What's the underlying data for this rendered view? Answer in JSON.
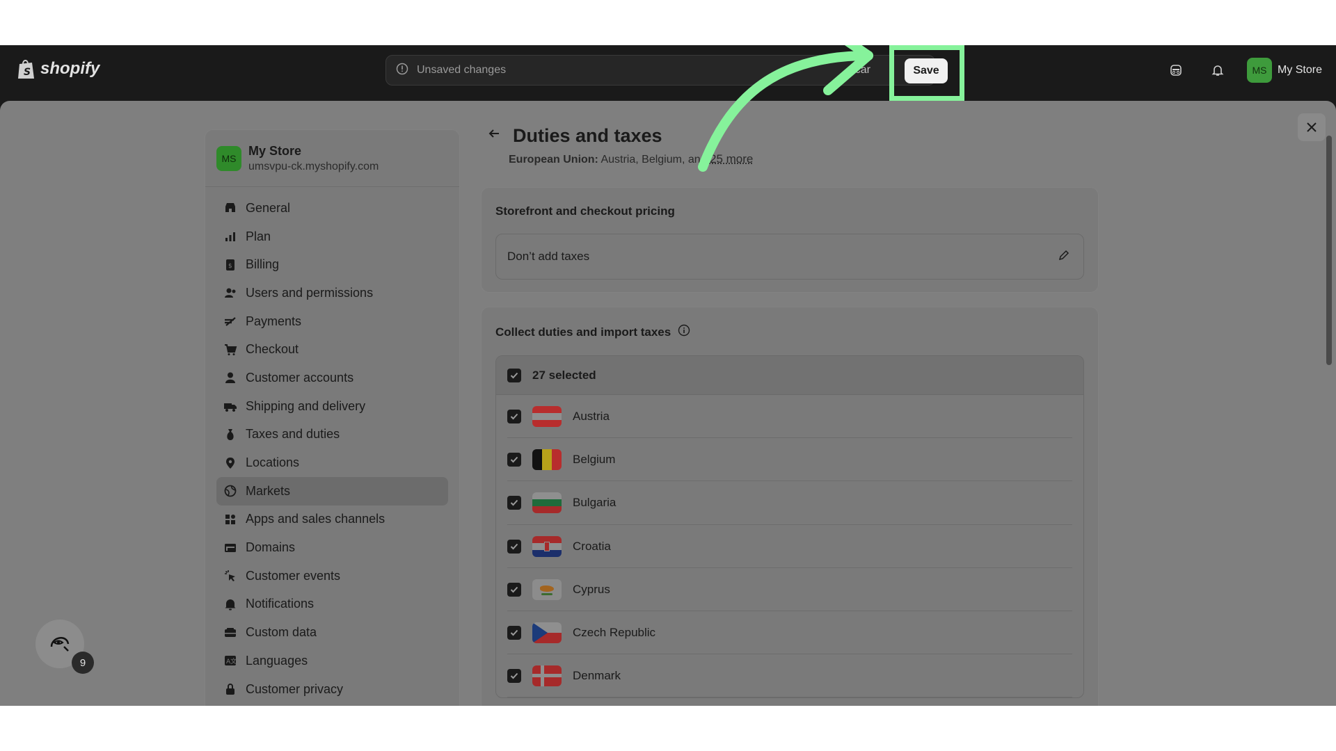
{
  "topbar": {
    "brand": "shopify",
    "unsaved_label": "Unsaved changes",
    "discard_label": "car",
    "save_label": "Save",
    "store_initials": "MS",
    "store_name": "My Store"
  },
  "sidebar": {
    "store_initials": "MS",
    "store_name": "My Store",
    "store_url": "umsvpu-ck.myshopify.com",
    "items": [
      {
        "label": "General",
        "icon": "store-icon"
      },
      {
        "label": "Plan",
        "icon": "plan-icon"
      },
      {
        "label": "Billing",
        "icon": "billing-icon"
      },
      {
        "label": "Users and permissions",
        "icon": "users-icon"
      },
      {
        "label": "Payments",
        "icon": "payments-icon"
      },
      {
        "label": "Checkout",
        "icon": "cart-icon"
      },
      {
        "label": "Customer accounts",
        "icon": "person-icon"
      },
      {
        "label": "Shipping and delivery",
        "icon": "truck-icon"
      },
      {
        "label": "Taxes and duties",
        "icon": "tax-icon"
      },
      {
        "label": "Locations",
        "icon": "location-icon"
      },
      {
        "label": "Markets",
        "icon": "globe-icon"
      },
      {
        "label": "Apps and sales channels",
        "icon": "apps-icon"
      },
      {
        "label": "Domains",
        "icon": "domains-icon"
      },
      {
        "label": "Customer events",
        "icon": "events-icon"
      },
      {
        "label": "Notifications",
        "icon": "bell-icon"
      },
      {
        "label": "Custom data",
        "icon": "data-icon"
      },
      {
        "label": "Languages",
        "icon": "languages-icon"
      },
      {
        "label": "Customer privacy",
        "icon": "lock-icon"
      }
    ],
    "active_item": "Markets"
  },
  "main": {
    "title": "Duties and taxes",
    "region_label": "European Union:",
    "region_countries": "Austria, Belgium, and",
    "region_more": "25 more",
    "pricing_card": {
      "title": "Storefront and checkout pricing",
      "value": "Don’t add taxes"
    },
    "duties_card": {
      "title": "Collect duties and import taxes",
      "selected_label": "27 selected",
      "countries": [
        "Austria",
        "Belgium",
        "Bulgaria",
        "Croatia",
        "Cyprus",
        "Czech Republic",
        "Denmark"
      ]
    }
  },
  "helper": {
    "count": "9"
  },
  "colors": {
    "highlight": "#86f29b",
    "topbar": "#1a1a1a",
    "overlay": "#7f7f7f",
    "store_avatar": "#3e9b3c"
  }
}
